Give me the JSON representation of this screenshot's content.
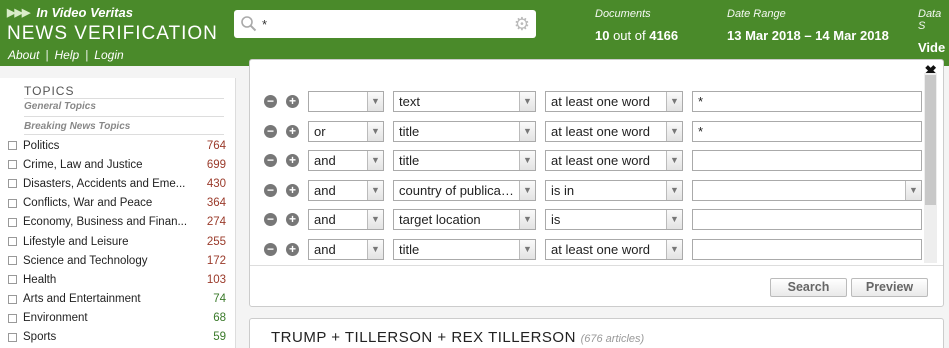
{
  "header": {
    "brand": "In Video Veritas",
    "app_title": "NEWS VERIFICATION",
    "links": [
      "About",
      "Help",
      "Login"
    ],
    "search": {
      "value": "*"
    },
    "stats": [
      {
        "label": "Documents",
        "value_main": "10",
        "value_mid": " out of ",
        "value_end": "4166"
      },
      {
        "label": "Date Range",
        "value_main": "13 Mar 2018 – 14 Mar 2018",
        "value_mid": "",
        "value_end": ""
      },
      {
        "label": "Data S",
        "value_main": "Vide",
        "value_mid": "",
        "value_end": ""
      }
    ]
  },
  "sidebar": {
    "title": "TOPICS",
    "general": "General Topics",
    "breaking": "Breaking News Topics",
    "topics": [
      {
        "name": "Politics",
        "count": "764"
      },
      {
        "name": "Crime, Law and Justice",
        "count": "699"
      },
      {
        "name": "Disasters, Accidents and Eme...",
        "count": "430"
      },
      {
        "name": "Conflicts, War and Peace",
        "count": "364"
      },
      {
        "name": "Economy, Business and Finan...",
        "count": "274"
      },
      {
        "name": "Lifestyle and Leisure",
        "count": "255"
      },
      {
        "name": "Science and Technology",
        "count": "172"
      },
      {
        "name": "Health",
        "count": "103"
      },
      {
        "name": "Arts and Entertainment",
        "count": "74"
      },
      {
        "name": "Environment",
        "count": "68"
      },
      {
        "name": "Sports",
        "count": "59"
      }
    ]
  },
  "query": {
    "rows": [
      {
        "op": "",
        "field": "text",
        "match": "at least one word",
        "value": "*",
        "value_is_select": false
      },
      {
        "op": "or",
        "field": "title",
        "match": "at least one word",
        "value": "*",
        "value_is_select": false
      },
      {
        "op": "and",
        "field": "title",
        "match": "at least one word",
        "value": "",
        "value_is_select": false
      },
      {
        "op": "and",
        "field": "country of publicat...",
        "match": "is in",
        "value": "",
        "value_is_select": true
      },
      {
        "op": "and",
        "field": "target location",
        "match": "is",
        "value": "",
        "value_is_select": false
      },
      {
        "op": "and",
        "field": "title",
        "match": "at least one word",
        "value": "",
        "value_is_select": false
      }
    ],
    "search_label": "Search",
    "preview_label": "Preview",
    "close": "✖"
  },
  "result": {
    "title": "TRUMP + TILLERSON + REX TILLERSON",
    "count": "(676 articles)"
  },
  "colors": {
    "header_bg": "#4a8a2a",
    "count_high": "#9a3a2a",
    "count_low": "#3a7a2a"
  }
}
